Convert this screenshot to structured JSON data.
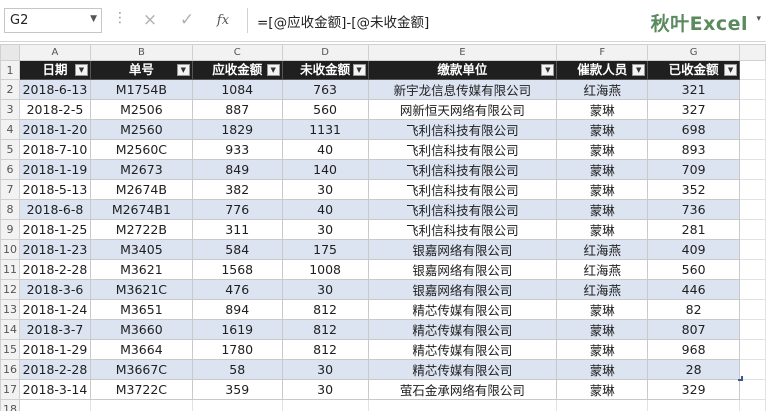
{
  "formula_bar": {
    "name_box": "G2",
    "cancel_icon": "×",
    "enter_icon": "✓",
    "fx_label": "fx",
    "formula": "=[@应收金额]-[@未收金额]",
    "brand": "秋叶Excel"
  },
  "column_letters": [
    "A",
    "B",
    "C",
    "D",
    "E",
    "F",
    "G"
  ],
  "headers": [
    "日期",
    "单号",
    "应收金额",
    "未收金额",
    "缴款单位",
    "催款人员",
    "已收金额"
  ],
  "rows": [
    [
      "2018-6-13",
      "M1754B",
      "1084",
      "763",
      "新宇龙信息传媒有限公司",
      "红海燕",
      "321"
    ],
    [
      "2018-2-5",
      "M2506",
      "887",
      "560",
      "网新恒天网络有限公司",
      "蒙琳",
      "327"
    ],
    [
      "2018-1-20",
      "M2560",
      "1829",
      "1131",
      "飞利信科技有限公司",
      "蒙琳",
      "698"
    ],
    [
      "2018-7-10",
      "M2560C",
      "933",
      "40",
      "飞利信科技有限公司",
      "蒙琳",
      "893"
    ],
    [
      "2018-1-19",
      "M2673",
      "849",
      "140",
      "飞利信科技有限公司",
      "蒙琳",
      "709"
    ],
    [
      "2018-5-13",
      "M2674B",
      "382",
      "30",
      "飞利信科技有限公司",
      "蒙琳",
      "352"
    ],
    [
      "2018-6-8",
      "M2674B1",
      "776",
      "40",
      "飞利信科技有限公司",
      "蒙琳",
      "736"
    ],
    [
      "2018-1-25",
      "M2722B",
      "311",
      "30",
      "飞利信科技有限公司",
      "蒙琳",
      "281"
    ],
    [
      "2018-1-23",
      "M3405",
      "584",
      "175",
      "银嘉网络有限公司",
      "红海燕",
      "409"
    ],
    [
      "2018-2-28",
      "M3621",
      "1568",
      "1008",
      "银嘉网络有限公司",
      "红海燕",
      "560"
    ],
    [
      "2018-3-6",
      "M3621C",
      "476",
      "30",
      "银嘉网络有限公司",
      "红海燕",
      "446"
    ],
    [
      "2018-1-24",
      "M3651",
      "894",
      "812",
      "精芯传媒有限公司",
      "蒙琳",
      "82"
    ],
    [
      "2018-3-7",
      "M3660",
      "1619",
      "812",
      "精芯传媒有限公司",
      "蒙琳",
      "807"
    ],
    [
      "2018-1-29",
      "M3664",
      "1780",
      "812",
      "精芯传媒有限公司",
      "蒙琳",
      "968"
    ],
    [
      "2018-2-28",
      "M3667C",
      "58",
      "30",
      "精芯传媒有限公司",
      "蒙琳",
      "28"
    ],
    [
      "2018-3-14",
      "M3722C",
      "359",
      "30",
      "萤石金承网络有限公司",
      "蒙琳",
      "329"
    ]
  ],
  "row_numbers": [
    "1",
    "2",
    "3",
    "4",
    "5",
    "6",
    "7",
    "8",
    "9",
    "10",
    "11",
    "12",
    "13",
    "14",
    "15",
    "16",
    "17",
    "18"
  ],
  "colors": {
    "header_bg": "#1f1f1f",
    "band": "#dce3f1",
    "brand": "#5a8a5e"
  }
}
